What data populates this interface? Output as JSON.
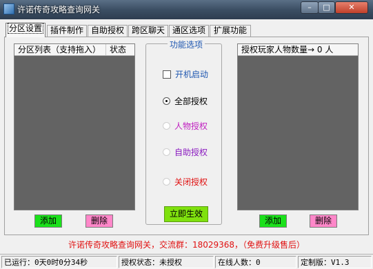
{
  "window": {
    "title": "许诺传奇攻略查询网关",
    "min_glyph": "–",
    "max_glyph": "□",
    "close_glyph": "✕"
  },
  "tabs": [
    {
      "label": "分区设置",
      "active": true
    },
    {
      "label": "插件制作",
      "active": false
    },
    {
      "label": "自助授权",
      "active": false
    },
    {
      "label": "跨区聊天",
      "active": false
    },
    {
      "label": "通区选项",
      "active": false
    },
    {
      "label": "扩展功能",
      "active": false
    }
  ],
  "zone_list": {
    "col_name": "分区列表（支持拖入）",
    "col_status": "状态",
    "add_label": "添加",
    "delete_label": "删除"
  },
  "options": {
    "group_title": "功能选项",
    "autostart_label": "开机启动",
    "autostart_checked": false,
    "radios": [
      {
        "label": "全部授权",
        "selected": true,
        "color": "#000000"
      },
      {
        "label": "人物授权",
        "selected": false,
        "color": "#c020c0"
      },
      {
        "label": "自助授权",
        "selected": false,
        "color": "#8a1ac0"
      },
      {
        "label": "关闭授权",
        "selected": false,
        "color": "#e01010"
      }
    ],
    "apply_label": "立即生效"
  },
  "auth_list": {
    "col_title": "授权玩家人物数量→ 0 人",
    "add_label": "添加",
    "delete_label": "删除"
  },
  "notice": "许诺传奇攻略查询网关，交流群：18029368，（免费升级售后）",
  "status": {
    "running": "已运行：0天0时0分34秒",
    "auth_state": "授权状态：未授权",
    "online": "在线人数：0",
    "edition": "定制版：V1.3"
  },
  "colors": {
    "accent_blue": "#1f57b0",
    "list_bg": "#636363",
    "add_green": "#1be11b",
    "delete_pink": "#ff87c9",
    "apply_green": "#7fe10e",
    "notice_red": "#e01010"
  }
}
